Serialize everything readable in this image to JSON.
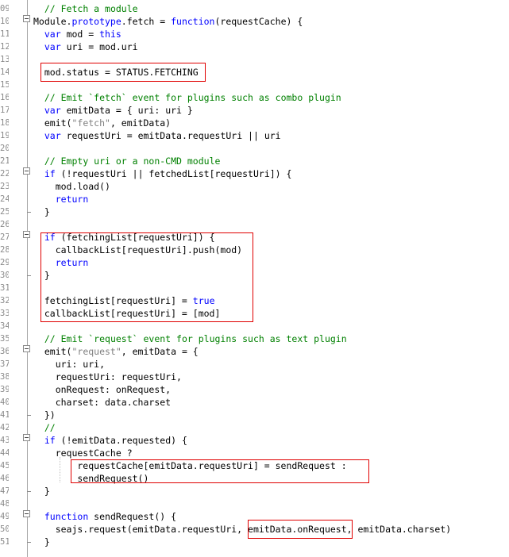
{
  "editor": {
    "lines": [
      {
        "no": "09",
        "segments": [
          {
            "t": "  ",
            "c": ""
          },
          {
            "t": "// Fetch a module",
            "c": "cm"
          }
        ]
      },
      {
        "no": "10",
        "segments": [
          {
            "t": "Module.",
            "c": ""
          },
          {
            "t": "prototype",
            "c": "kw"
          },
          {
            "t": ".fetch = ",
            "c": ""
          },
          {
            "t": "function",
            "c": "kw"
          },
          {
            "t": "(requestCache) {",
            "c": ""
          }
        ]
      },
      {
        "no": "11",
        "segments": [
          {
            "t": "  ",
            "c": ""
          },
          {
            "t": "var",
            "c": "kw"
          },
          {
            "t": " mod = ",
            "c": ""
          },
          {
            "t": "this",
            "c": "kw"
          }
        ]
      },
      {
        "no": "12",
        "segments": [
          {
            "t": "  ",
            "c": ""
          },
          {
            "t": "var",
            "c": "kw"
          },
          {
            "t": " uri = mod.uri",
            "c": ""
          }
        ]
      },
      {
        "no": "13",
        "segments": []
      },
      {
        "no": "14",
        "segments": [
          {
            "t": "  mod.status = STATUS.FETCHING",
            "c": ""
          }
        ]
      },
      {
        "no": "15",
        "segments": []
      },
      {
        "no": "16",
        "segments": [
          {
            "t": "  ",
            "c": ""
          },
          {
            "t": "// Emit `fetch` event for plugins such as combo plugin",
            "c": "cm"
          }
        ]
      },
      {
        "no": "17",
        "segments": [
          {
            "t": "  ",
            "c": ""
          },
          {
            "t": "var",
            "c": "kw"
          },
          {
            "t": " emitData = { uri: uri }",
            "c": ""
          }
        ]
      },
      {
        "no": "18",
        "segments": [
          {
            "t": "  emit(",
            "c": ""
          },
          {
            "t": "\"fetch\"",
            "c": "st"
          },
          {
            "t": ", emitData)",
            "c": ""
          }
        ]
      },
      {
        "no": "19",
        "segments": [
          {
            "t": "  ",
            "c": ""
          },
          {
            "t": "var",
            "c": "kw"
          },
          {
            "t": " requestUri = emitData.requestUri || uri",
            "c": ""
          }
        ]
      },
      {
        "no": "20",
        "segments": []
      },
      {
        "no": "21",
        "segments": [
          {
            "t": "  ",
            "c": ""
          },
          {
            "t": "// Empty uri or a non-CMD module",
            "c": "cm"
          }
        ]
      },
      {
        "no": "22",
        "segments": [
          {
            "t": "  ",
            "c": ""
          },
          {
            "t": "if",
            "c": "kw"
          },
          {
            "t": " (!requestUri || fetchedList[requestUri]) {",
            "c": ""
          }
        ]
      },
      {
        "no": "23",
        "segments": [
          {
            "t": "    mod.load()",
            "c": ""
          }
        ]
      },
      {
        "no": "24",
        "segments": [
          {
            "t": "    ",
            "c": ""
          },
          {
            "t": "return",
            "c": "kw"
          }
        ]
      },
      {
        "no": "25",
        "segments": [
          {
            "t": "  }",
            "c": ""
          }
        ]
      },
      {
        "no": "26",
        "segments": []
      },
      {
        "no": "27",
        "segments": [
          {
            "t": "  ",
            "c": ""
          },
          {
            "t": "if",
            "c": "kw"
          },
          {
            "t": " (fetchingList[requestUri]) {",
            "c": ""
          }
        ]
      },
      {
        "no": "28",
        "segments": [
          {
            "t": "    callbackList[requestUri].push(mod)",
            "c": ""
          }
        ]
      },
      {
        "no": "29",
        "segments": [
          {
            "t": "    ",
            "c": ""
          },
          {
            "t": "return",
            "c": "kw"
          }
        ]
      },
      {
        "no": "30",
        "segments": [
          {
            "t": "  }",
            "c": ""
          }
        ]
      },
      {
        "no": "31",
        "segments": []
      },
      {
        "no": "32",
        "segments": [
          {
            "t": "  fetchingList[requestUri] = ",
            "c": ""
          },
          {
            "t": "true",
            "c": "kw"
          }
        ]
      },
      {
        "no": "33",
        "segments": [
          {
            "t": "  callbackList[requestUri] = [mod]",
            "c": ""
          }
        ]
      },
      {
        "no": "34",
        "segments": []
      },
      {
        "no": "35",
        "segments": [
          {
            "t": "  ",
            "c": ""
          },
          {
            "t": "// Emit `request` event for plugins such as text plugin",
            "c": "cm"
          }
        ]
      },
      {
        "no": "36",
        "segments": [
          {
            "t": "  emit(",
            "c": ""
          },
          {
            "t": "\"request\"",
            "c": "st"
          },
          {
            "t": ", emitData = {",
            "c": ""
          }
        ]
      },
      {
        "no": "37",
        "segments": [
          {
            "t": "    uri: uri,",
            "c": ""
          }
        ]
      },
      {
        "no": "38",
        "segments": [
          {
            "t": "    requestUri: requestUri,",
            "c": ""
          }
        ]
      },
      {
        "no": "39",
        "segments": [
          {
            "t": "    onRequest: onRequest,",
            "c": ""
          }
        ]
      },
      {
        "no": "40",
        "segments": [
          {
            "t": "    charset: data.charset",
            "c": ""
          }
        ]
      },
      {
        "no": "41",
        "segments": [
          {
            "t": "  })",
            "c": ""
          }
        ]
      },
      {
        "no": "42",
        "segments": [
          {
            "t": "  ",
            "c": ""
          },
          {
            "t": "//",
            "c": "cm"
          }
        ]
      },
      {
        "no": "43",
        "segments": [
          {
            "t": "  ",
            "c": ""
          },
          {
            "t": "if",
            "c": "kw"
          },
          {
            "t": " (!emitData.requested) {",
            "c": ""
          }
        ]
      },
      {
        "no": "44",
        "segments": [
          {
            "t": "    requestCache ?",
            "c": ""
          }
        ]
      },
      {
        "no": "45",
        "segments": [
          {
            "t": "        requestCache[emitData.requestUri] = sendRequest :",
            "c": ""
          }
        ]
      },
      {
        "no": "46",
        "segments": [
          {
            "t": "        sendRequest()",
            "c": ""
          }
        ]
      },
      {
        "no": "47",
        "segments": [
          {
            "t": "  }",
            "c": ""
          }
        ]
      },
      {
        "no": "48",
        "segments": []
      },
      {
        "no": "49",
        "segments": [
          {
            "t": "  ",
            "c": ""
          },
          {
            "t": "function",
            "c": "kw"
          },
          {
            "t": " sendRequest() {",
            "c": ""
          }
        ]
      },
      {
        "no": "50",
        "segments": [
          {
            "t": "    seajs.request(emitData.requestUri, emitData.onRequest, emitData.charset)",
            "c": ""
          }
        ]
      },
      {
        "no": "51",
        "segments": [
          {
            "t": "  }",
            "c": ""
          }
        ]
      }
    ]
  },
  "colors": {
    "keyword": "#0000ff",
    "comment": "#008000",
    "string": "#808080",
    "highlight_border": "#e00000",
    "line_number": "#8a8a8a"
  }
}
